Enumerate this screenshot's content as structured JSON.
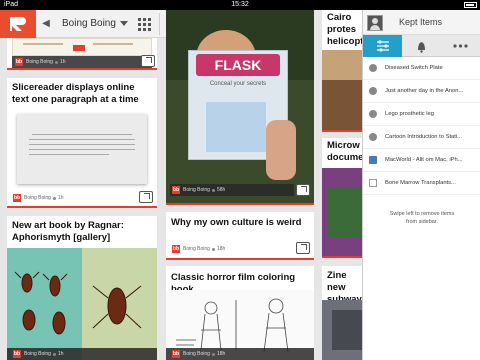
{
  "status": {
    "carrier": "iPad",
    "time": "15:32"
  },
  "toolbar": {
    "feed_name": "Boing Boing",
    "back_label": "◀"
  },
  "cards": {
    "top_strip": {
      "source": "Boing Boing",
      "time": "1h"
    },
    "slicereader": {
      "title": "Slicereader displays online text one paragraph at a time",
      "source": "Boing Boing",
      "time": "1h"
    },
    "art_book": {
      "title": "New art book by Ragnar: Aphorismyth [gallery]",
      "source": "Boing Boing",
      "time": "1h"
    },
    "flask": {
      "source": "Boing Boing",
      "time": "58h"
    },
    "culture": {
      "title": "Why my own culture is weird",
      "source": "Boing Boing",
      "time": "18h"
    },
    "horror": {
      "title": "Classic horror film coloring book",
      "source": "Boing Boing",
      "time": "18h"
    },
    "cairo": {
      "title": "Cairo protes helicopte"
    },
    "microwave": {
      "title": "Microw docume"
    },
    "zine": {
      "title": "Zine new subway"
    }
  },
  "flask_art": {
    "headline": "FLASK",
    "subline": "Conceal your secrets"
  },
  "kept_panel": {
    "title": "Kept Items",
    "items": [
      "Diseased Switch Plate",
      "Just another day in the Anon...",
      "Lego prosthetic leg",
      "Cartoon Introduction to Stati...",
      "MacWorld - Allt om Mac, iPh...",
      "Bone Marrow Transplants..."
    ],
    "hint_line1": "Swipe left to remove items",
    "hint_line2": "from sidebar."
  },
  "colors": {
    "accent": "#e53e2a",
    "logo": "#ea4c2f",
    "panel_tab": "#22a0c8"
  }
}
